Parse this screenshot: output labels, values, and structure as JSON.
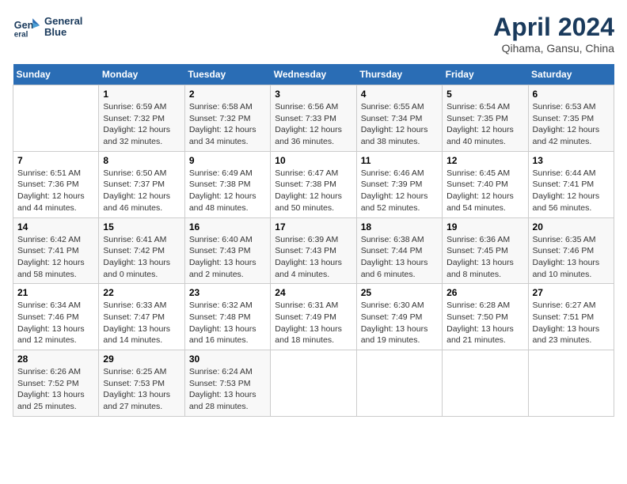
{
  "header": {
    "logo_line1": "General",
    "logo_line2": "Blue",
    "title": "April 2024",
    "subtitle": "Qihama, Gansu, China"
  },
  "days_of_week": [
    "Sunday",
    "Monday",
    "Tuesday",
    "Wednesday",
    "Thursday",
    "Friday",
    "Saturday"
  ],
  "weeks": [
    [
      {
        "num": "",
        "info": ""
      },
      {
        "num": "1",
        "info": "Sunrise: 6:59 AM\nSunset: 7:32 PM\nDaylight: 12 hours\nand 32 minutes."
      },
      {
        "num": "2",
        "info": "Sunrise: 6:58 AM\nSunset: 7:32 PM\nDaylight: 12 hours\nand 34 minutes."
      },
      {
        "num": "3",
        "info": "Sunrise: 6:56 AM\nSunset: 7:33 PM\nDaylight: 12 hours\nand 36 minutes."
      },
      {
        "num": "4",
        "info": "Sunrise: 6:55 AM\nSunset: 7:34 PM\nDaylight: 12 hours\nand 38 minutes."
      },
      {
        "num": "5",
        "info": "Sunrise: 6:54 AM\nSunset: 7:35 PM\nDaylight: 12 hours\nand 40 minutes."
      },
      {
        "num": "6",
        "info": "Sunrise: 6:53 AM\nSunset: 7:35 PM\nDaylight: 12 hours\nand 42 minutes."
      }
    ],
    [
      {
        "num": "7",
        "info": "Sunrise: 6:51 AM\nSunset: 7:36 PM\nDaylight: 12 hours\nand 44 minutes."
      },
      {
        "num": "8",
        "info": "Sunrise: 6:50 AM\nSunset: 7:37 PM\nDaylight: 12 hours\nand 46 minutes."
      },
      {
        "num": "9",
        "info": "Sunrise: 6:49 AM\nSunset: 7:38 PM\nDaylight: 12 hours\nand 48 minutes."
      },
      {
        "num": "10",
        "info": "Sunrise: 6:47 AM\nSunset: 7:38 PM\nDaylight: 12 hours\nand 50 minutes."
      },
      {
        "num": "11",
        "info": "Sunrise: 6:46 AM\nSunset: 7:39 PM\nDaylight: 12 hours\nand 52 minutes."
      },
      {
        "num": "12",
        "info": "Sunrise: 6:45 AM\nSunset: 7:40 PM\nDaylight: 12 hours\nand 54 minutes."
      },
      {
        "num": "13",
        "info": "Sunrise: 6:44 AM\nSunset: 7:41 PM\nDaylight: 12 hours\nand 56 minutes."
      }
    ],
    [
      {
        "num": "14",
        "info": "Sunrise: 6:42 AM\nSunset: 7:41 PM\nDaylight: 12 hours\nand 58 minutes."
      },
      {
        "num": "15",
        "info": "Sunrise: 6:41 AM\nSunset: 7:42 PM\nDaylight: 13 hours\nand 0 minutes."
      },
      {
        "num": "16",
        "info": "Sunrise: 6:40 AM\nSunset: 7:43 PM\nDaylight: 13 hours\nand 2 minutes."
      },
      {
        "num": "17",
        "info": "Sunrise: 6:39 AM\nSunset: 7:43 PM\nDaylight: 13 hours\nand 4 minutes."
      },
      {
        "num": "18",
        "info": "Sunrise: 6:38 AM\nSunset: 7:44 PM\nDaylight: 13 hours\nand 6 minutes."
      },
      {
        "num": "19",
        "info": "Sunrise: 6:36 AM\nSunset: 7:45 PM\nDaylight: 13 hours\nand 8 minutes."
      },
      {
        "num": "20",
        "info": "Sunrise: 6:35 AM\nSunset: 7:46 PM\nDaylight: 13 hours\nand 10 minutes."
      }
    ],
    [
      {
        "num": "21",
        "info": "Sunrise: 6:34 AM\nSunset: 7:46 PM\nDaylight: 13 hours\nand 12 minutes."
      },
      {
        "num": "22",
        "info": "Sunrise: 6:33 AM\nSunset: 7:47 PM\nDaylight: 13 hours\nand 14 minutes."
      },
      {
        "num": "23",
        "info": "Sunrise: 6:32 AM\nSunset: 7:48 PM\nDaylight: 13 hours\nand 16 minutes."
      },
      {
        "num": "24",
        "info": "Sunrise: 6:31 AM\nSunset: 7:49 PM\nDaylight: 13 hours\nand 18 minutes."
      },
      {
        "num": "25",
        "info": "Sunrise: 6:30 AM\nSunset: 7:49 PM\nDaylight: 13 hours\nand 19 minutes."
      },
      {
        "num": "26",
        "info": "Sunrise: 6:28 AM\nSunset: 7:50 PM\nDaylight: 13 hours\nand 21 minutes."
      },
      {
        "num": "27",
        "info": "Sunrise: 6:27 AM\nSunset: 7:51 PM\nDaylight: 13 hours\nand 23 minutes."
      }
    ],
    [
      {
        "num": "28",
        "info": "Sunrise: 6:26 AM\nSunset: 7:52 PM\nDaylight: 13 hours\nand 25 minutes."
      },
      {
        "num": "29",
        "info": "Sunrise: 6:25 AM\nSunset: 7:53 PM\nDaylight: 13 hours\nand 27 minutes."
      },
      {
        "num": "30",
        "info": "Sunrise: 6:24 AM\nSunset: 7:53 PM\nDaylight: 13 hours\nand 28 minutes."
      },
      {
        "num": "",
        "info": ""
      },
      {
        "num": "",
        "info": ""
      },
      {
        "num": "",
        "info": ""
      },
      {
        "num": "",
        "info": ""
      }
    ]
  ]
}
